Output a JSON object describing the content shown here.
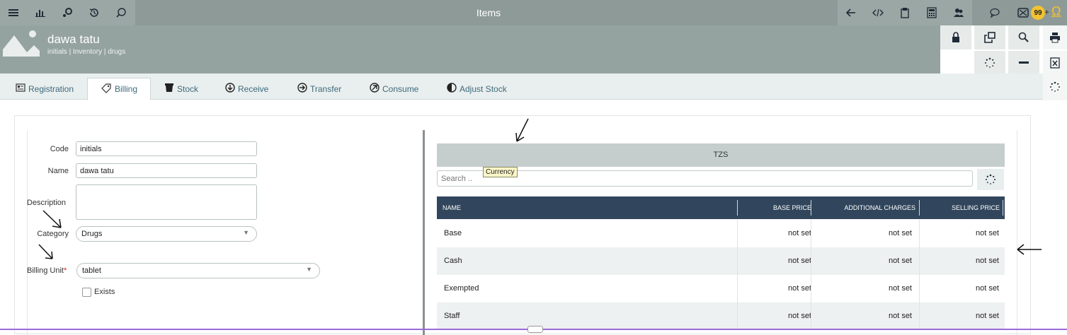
{
  "window": {
    "title": "Items"
  },
  "record": {
    "name": "dawa tatu",
    "path": "initials | Inventory | drugs"
  },
  "notifications": {
    "count": "99",
    "plus": "+"
  },
  "tabs": [
    {
      "label": "Registration",
      "icon": "registration-icon"
    },
    {
      "label": "Billing",
      "icon": "billing-tag-icon"
    },
    {
      "label": "Stock",
      "icon": "stock-bin-icon"
    },
    {
      "label": "Receive",
      "icon": "receive-icon"
    },
    {
      "label": "Transfer",
      "icon": "transfer-icon"
    },
    {
      "label": "Consume",
      "icon": "consume-icon"
    },
    {
      "label": "Adjust Stock",
      "icon": "adjust-stock-icon"
    }
  ],
  "form": {
    "code_label": "Code",
    "code_value": "initials",
    "name_label": "Name",
    "name_value": "dawa tatu",
    "description_label": "Description",
    "description_value": "",
    "category_label": "Category",
    "category_value": "Drugs",
    "billing_unit_label": "Billing Unit",
    "billing_unit_required": "*",
    "billing_unit_value": "tablet",
    "exists_label": "Exists"
  },
  "pricing": {
    "currency": "TZS",
    "currency_tooltip": "Currency",
    "search_placeholder": "Search ..",
    "columns": [
      "NAME",
      "BASE PRICE",
      "ADDITIONAL CHARGES",
      "SELLING PRICE"
    ],
    "rows": [
      {
        "name": "Base",
        "base": "not set",
        "additional": "not set",
        "selling": "not set"
      },
      {
        "name": "Cash",
        "base": "not set",
        "additional": "not set",
        "selling": "not set"
      },
      {
        "name": "Exempted",
        "base": "not set",
        "additional": "not set",
        "selling": "not set"
      },
      {
        "name": "Staff",
        "base": "not set",
        "additional": "not set",
        "selling": "not set"
      }
    ]
  },
  "colors": {
    "toolbar": "#8d9a98",
    "header": "#95a3a0",
    "table_header": "#31465c",
    "badge": "#f2c232",
    "tab_text": "#3d6a7c"
  }
}
